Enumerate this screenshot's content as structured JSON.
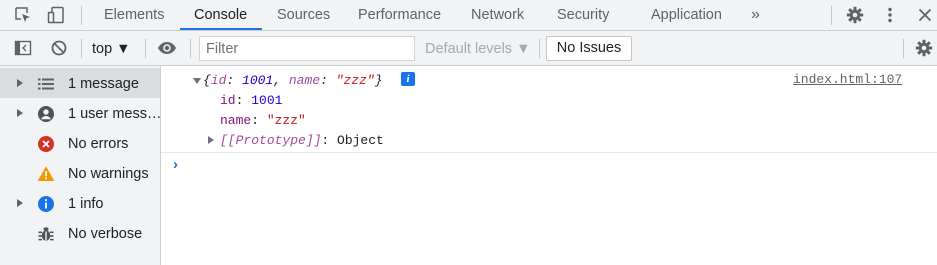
{
  "tabs": [
    {
      "label": "Elements"
    },
    {
      "label": "Console"
    },
    {
      "label": "Sources"
    },
    {
      "label": "Performance"
    },
    {
      "label": "Network"
    },
    {
      "label": "Security"
    },
    {
      "label": "Application"
    }
  ],
  "tabbar": {
    "more_tabs": "»",
    "icons": [
      "inspect-element-icon",
      "device-toggle-icon",
      "settings-icon",
      "more-options-icon",
      "close-icon"
    ]
  },
  "toolbar": {
    "context": "top ▼",
    "filter_placeholder": "Filter",
    "levels": "Default levels ▼",
    "issues_button": "No Issues",
    "icons": [
      "show-sidebar-icon",
      "clear-console-icon",
      "live-expression-eye-icon",
      "console-settings-icon"
    ]
  },
  "sidebar": {
    "items": [
      {
        "label": "1 message",
        "icon": "list-icon",
        "expandable": true,
        "selected": true
      },
      {
        "label": "1 user mess…",
        "icon": "user-icon",
        "expandable": true,
        "selected": false
      },
      {
        "label": "No errors",
        "icon": "error-icon",
        "expandable": false,
        "selected": false
      },
      {
        "label": "No warnings",
        "icon": "warning-icon",
        "expandable": false,
        "selected": false
      },
      {
        "label": "1 info",
        "icon": "info-icon",
        "expandable": true,
        "selected": false
      },
      {
        "label": "No verbose",
        "icon": "bug-icon",
        "expandable": false,
        "selected": false
      }
    ]
  },
  "console": {
    "message": {
      "preview_open": "{",
      "preview_id_key": "id",
      "preview_sep1": ": ",
      "preview_id_val": "1001",
      "preview_comma": ", ",
      "preview_name_key": "name",
      "preview_sep2": ": ",
      "preview_name_val": "\"zzz\"",
      "preview_close": "}",
      "info_badge": "i",
      "source": "index.html:107",
      "props": [
        {
          "key": "id",
          "sep": ": ",
          "value": "1001"
        },
        {
          "key": "name",
          "sep": ": ",
          "value": "\"zzz\""
        }
      ],
      "prototype_key": "[[Prototype]]",
      "prototype_sep": ": ",
      "prototype_value": "Object"
    },
    "prompt": "›"
  },
  "colors": {
    "accent": "#1a73e8",
    "error": "#d93025",
    "warning": "#f29900",
    "key": "#881280",
    "number": "#1c00cf",
    "string": "#c41a16"
  }
}
